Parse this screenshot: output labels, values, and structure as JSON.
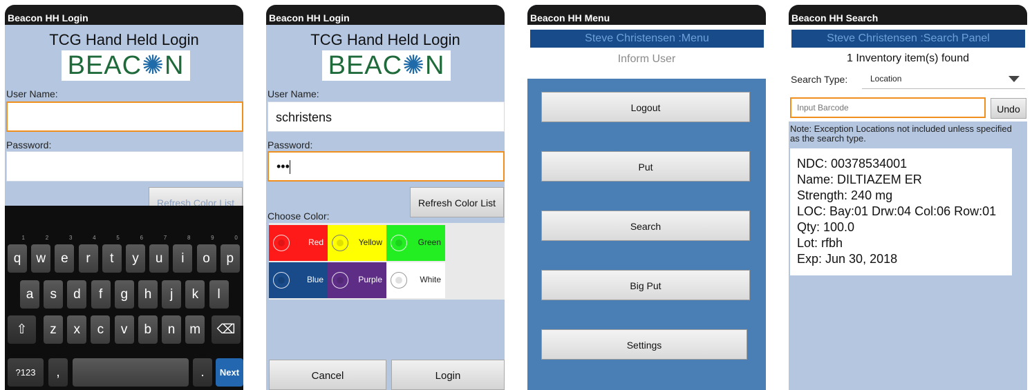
{
  "screen1": {
    "titlebar": "Beacon HH Login",
    "heading": "TCG Hand Held Login",
    "logo": {
      "pre": "BEAC",
      "star": "✺",
      "post": "N"
    },
    "user_label": "User Name:",
    "user_value": "",
    "password_label": "Password:",
    "password_value": "",
    "refresh_button": "Refresh Color List",
    "keyboard": {
      "row1": [
        {
          "k": "q",
          "n": "1"
        },
        {
          "k": "w",
          "n": "2"
        },
        {
          "k": "e",
          "n": "3"
        },
        {
          "k": "r",
          "n": "4"
        },
        {
          "k": "t",
          "n": "5"
        },
        {
          "k": "y",
          "n": "6"
        },
        {
          "k": "u",
          "n": "7"
        },
        {
          "k": "i",
          "n": "8"
        },
        {
          "k": "o",
          "n": "9"
        },
        {
          "k": "p",
          "n": "0"
        }
      ],
      "row2": [
        "a",
        "s",
        "d",
        "f",
        "g",
        "h",
        "j",
        "k",
        "l"
      ],
      "row3": [
        "z",
        "x",
        "c",
        "v",
        "b",
        "n",
        "m"
      ],
      "shift_icon": "shift-icon",
      "backspace_icon": "backspace-icon",
      "sym_key": "?123",
      "comma_key": ",",
      "period_key": ".",
      "next_key": "Next"
    }
  },
  "screen2": {
    "titlebar": "Beacon HH Login",
    "heading": "TCG Hand Held Login",
    "logo": {
      "pre": "BEAC",
      "star": "✺",
      "post": "N"
    },
    "user_label": "User Name:",
    "user_value": "schristens",
    "password_label": "Password:",
    "password_value": "•••",
    "refresh_button": "Refresh Color List",
    "choose_color_label": "Choose Color:",
    "colors": [
      {
        "name": "Red",
        "bg": "#ff1a1a",
        "fg": "#ffffff"
      },
      {
        "name": "Yellow",
        "bg": "#ffff00",
        "fg": "#222222"
      },
      {
        "name": "Green",
        "bg": "#22ee22",
        "fg": "#222222"
      },
      {
        "name": "Blue",
        "bg": "#194a8a",
        "fg": "#ffffff"
      },
      {
        "name": "Purple",
        "bg": "#5e2e86",
        "fg": "#ffffff"
      },
      {
        "name": "White",
        "bg": "#ffffff",
        "fg": "#222222"
      }
    ],
    "cancel_button": "Cancel",
    "login_button": "Login"
  },
  "screen3": {
    "titlebar": "Beacon HH Menu",
    "header": "Steve Christensen :Menu",
    "subheader": "Inform User",
    "buttons": [
      "Logout",
      "Put",
      "Search",
      "Big Put",
      "Settings"
    ]
  },
  "screen4": {
    "titlebar": "Beacon HH Search",
    "header": "Steve Christensen :Search Panel",
    "found_text": "1 Inventory item(s) found",
    "search_type_label": "Search Type:",
    "search_type_value": "Location",
    "barcode_placeholder": "Input Barcode",
    "undo_button": "Undo",
    "note": "Note: Exception Locations not included unless specified as the search type.",
    "result_lines": [
      "NDC: 00378534001",
      "Name: DILTIAZEM ER",
      "Strength: 240 mg",
      "LOC: Bay:01 Drw:04 Col:06 Row:01",
      "Qty: 100.0",
      "Lot: rfbh",
      "Exp: Jun 30, 2018"
    ]
  },
  "colors": {
    "accent_focus": "#f18f1e",
    "panel_bg": "#b4c6e0",
    "menu_bg": "#4a7fb6",
    "header_bar": "#184b8a"
  }
}
